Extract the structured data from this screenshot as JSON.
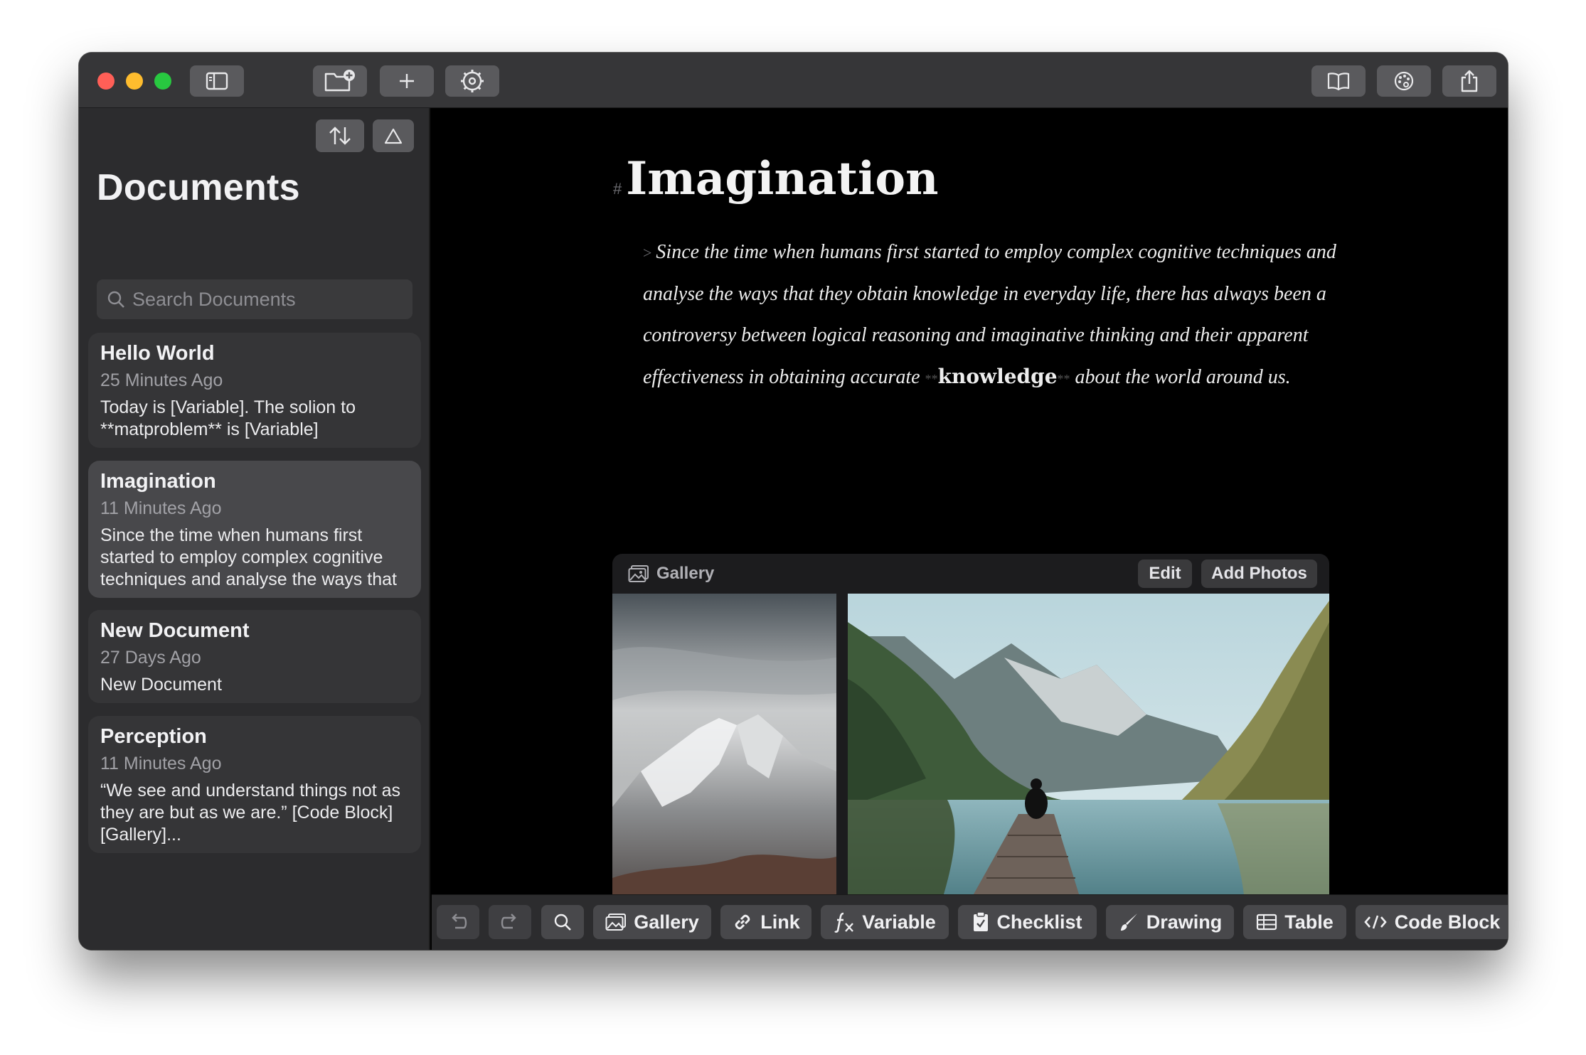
{
  "titlebar": {
    "toggle_sidebar_icon": "sidebar-icon",
    "new_folder_icon": "folder-plus-icon",
    "add_icon": "plus-icon",
    "settings_icon": "gear-icon",
    "reader_icon": "book-icon",
    "theme_icon": "palette-icon",
    "share_icon": "share-icon"
  },
  "sidebar": {
    "title": "Documents",
    "search_placeholder": "Search Documents",
    "sort_icon": "sort-arrows-icon",
    "filter_icon": "triangle-icon",
    "documents": [
      {
        "title": "Hello World",
        "date": "25 Minutes Ago",
        "snippet": "Today is [Variable]. The solion to **matproblem** is [Variable]"
      },
      {
        "title": "Imagination",
        "date": "11 Minutes Ago",
        "snippet": "Since the time when humans first started to employ complex cognitive techniques and analyse the ways that they ob..."
      },
      {
        "title": "New Document",
        "date": "27 Days Ago",
        "snippet": "New Document"
      },
      {
        "title": "Perception",
        "date": "11 Minutes Ago",
        "snippet": "“We see and understand things not as they are but as we are.” [Code Block] [Gallery]..."
      }
    ]
  },
  "editor": {
    "heading_marker": "#",
    "title": "Imagination",
    "quote_marker": ">",
    "quote_before": "Since the time when humans first started to employ complex cognitive techniques and analyse the ways that they obtain knowledge in everyday life, there has always been a controversy between logical reasoning and imaginative thinking and their apparent effectiveness in obtaining accurate",
    "bold_marker": "**",
    "quote_bold": "knowledge",
    "quote_after": "about the world around us.",
    "gallery": {
      "label": "Gallery",
      "edit_label": "Edit",
      "add_photos_label": "Add Photos"
    }
  },
  "toolbar": {
    "undo_icon": "undo-icon",
    "redo_icon": "redo-icon",
    "search_icon": "search-icon",
    "gallery_label": "Gallery",
    "link_label": "Link",
    "variable_label": "Variable",
    "checklist_label": "Checklist",
    "drawing_label": "Drawing",
    "table_label": "Table",
    "code_block_label": "Code Block"
  },
  "colors": {
    "close": "#ff5f57",
    "minimize": "#febc2e",
    "zoom": "#28c840",
    "sidebar_bg": "#2c2c2e",
    "editor_bg": "#000000"
  }
}
